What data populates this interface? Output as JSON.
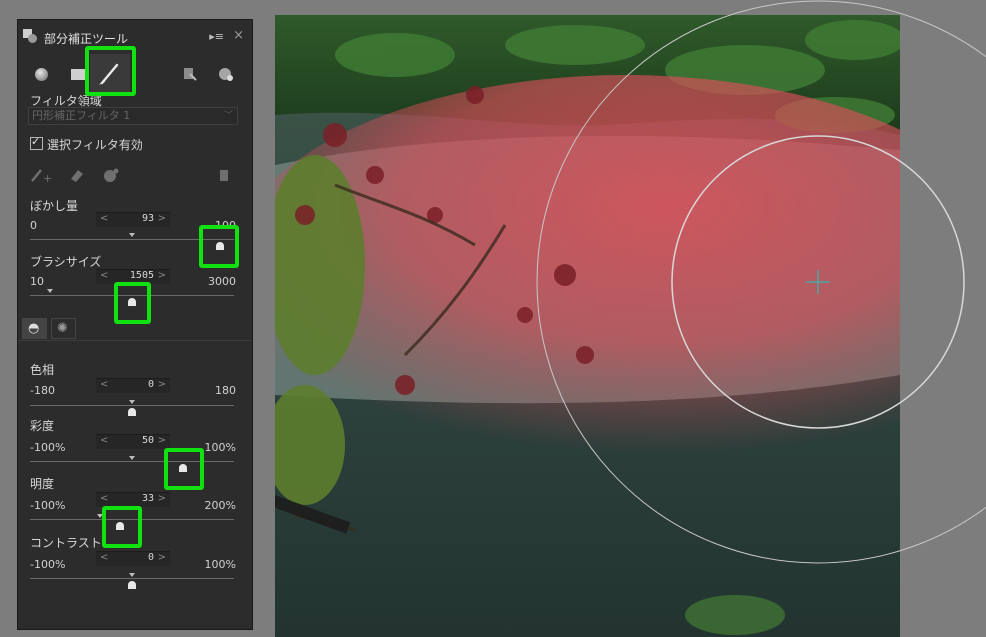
{
  "panel": {
    "title": "部分補正ツール",
    "menu_glyph": "▸≡",
    "close_glyph": "×",
    "filter_area_label": "フィルタ領域",
    "filter_select_value": "円形補正フィルタ 1",
    "enable_filter_label": "選択フィルタ有効",
    "blur": {
      "label": "ぼかし量",
      "min": "0",
      "max": "100",
      "value": "93",
      "level_percent": 93
    },
    "brush_size": {
      "label": "ブラシサイズ",
      "min": "10",
      "max": "3000",
      "value": "1505",
      "level_percent": 50
    },
    "hue": {
      "label": "色相",
      "min": "-180",
      "max": "180",
      "value": "0",
      "level_percent": 50
    },
    "saturation": {
      "label": "彩度",
      "min": "-100%",
      "max": "100%",
      "value": "50",
      "level_percent": 75
    },
    "brightness": {
      "label": "明度",
      "min": "-100%",
      "max": "200%",
      "value": "33",
      "level_percent": 44
    },
    "contrast": {
      "label": "コントラスト",
      "min": "-100%",
      "max": "100%",
      "value": "0",
      "level_percent": 50
    }
  },
  "colors": {
    "highlight": "#11e011",
    "panel_bg": "#2c2c2c",
    "mask_overlay": "#e0505a"
  }
}
